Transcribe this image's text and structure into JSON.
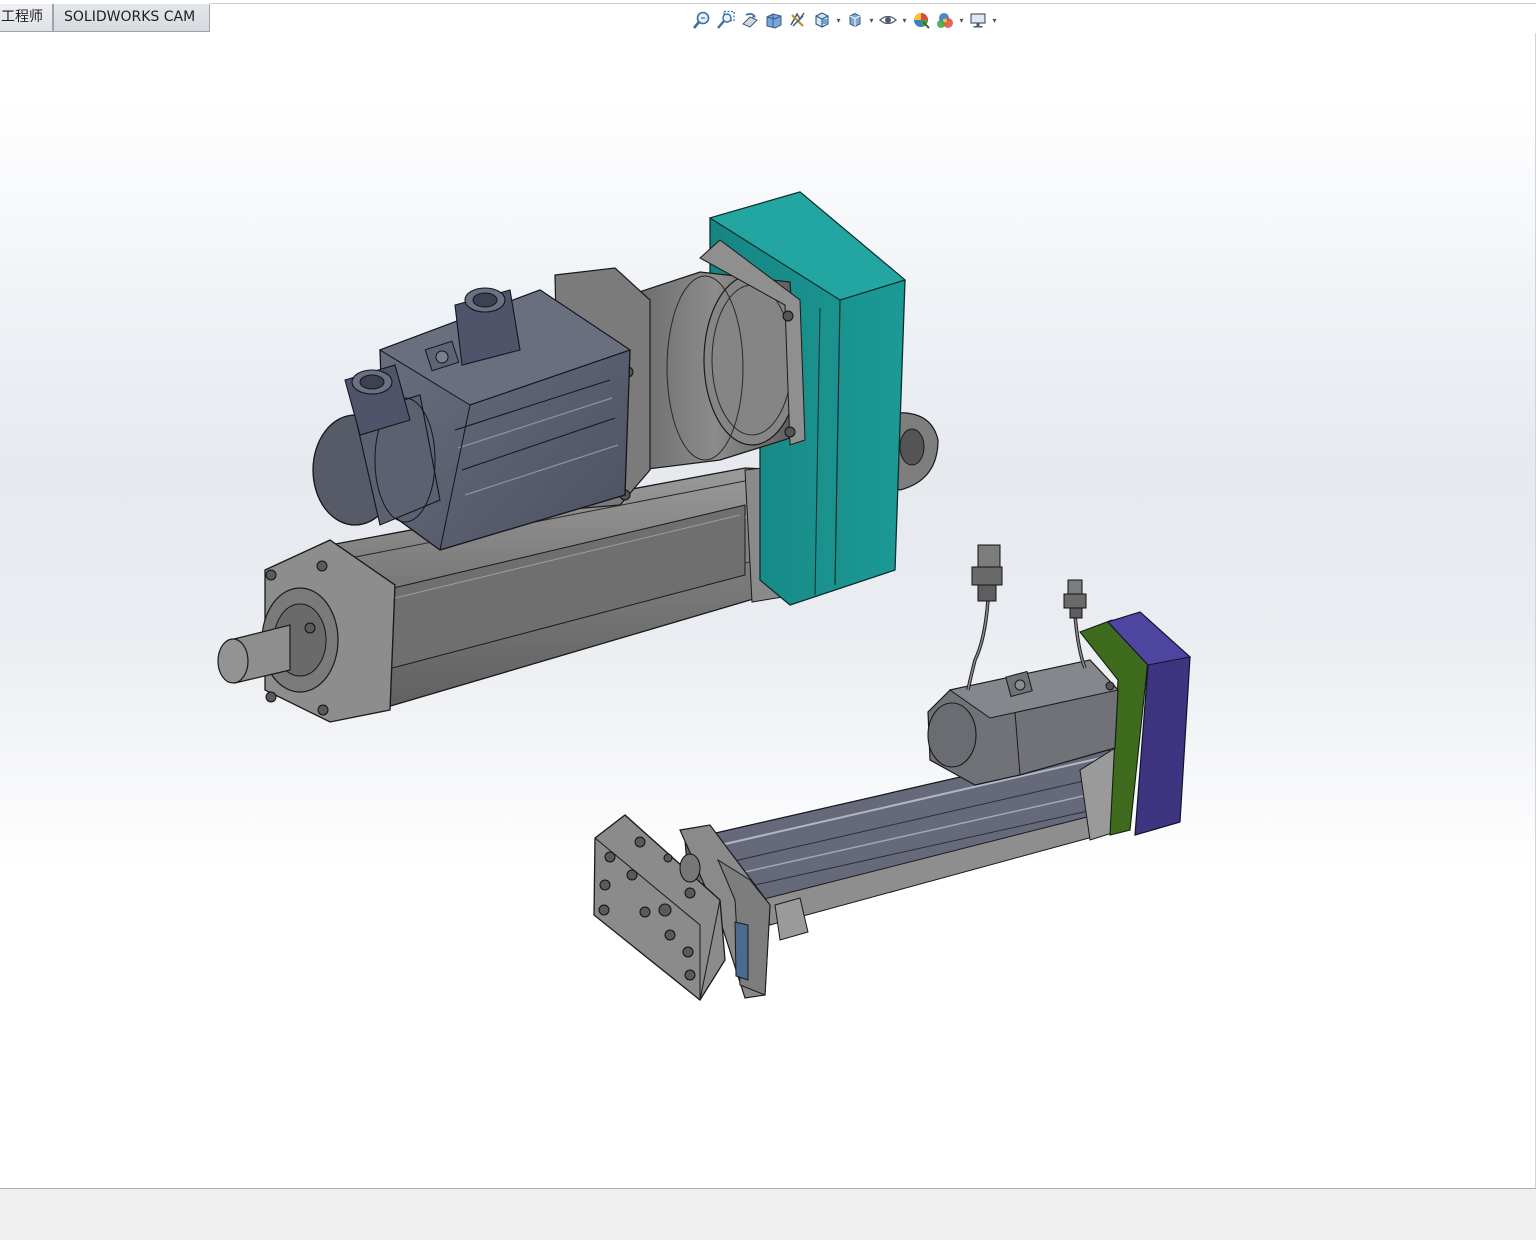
{
  "command_tabs": {
    "engineer_label": "工程师",
    "cam_label": "SOLIDWORKS CAM"
  },
  "heads_up_toolbar": {
    "items": [
      {
        "icon": "zoom-to-fit-icon"
      },
      {
        "icon": "zoom-to-area-icon"
      },
      {
        "icon": "previous-view-icon"
      },
      {
        "icon": "section-view-icon"
      },
      {
        "icon": "dynamic-annotation-icon"
      },
      {
        "icon": "view-orientation-icon"
      },
      {
        "icon": "display-style-icon"
      },
      {
        "icon": "hide-show-items-icon"
      },
      {
        "icon": "edit-appearance-icon"
      },
      {
        "icon": "apply-scene-icon"
      },
      {
        "icon": "view-settings-icon"
      }
    ]
  },
  "model": {
    "assemblies": [
      {
        "name": "large-servo-electric-cylinder",
        "housing_color": "#1a8f8c",
        "motor_color": "#5e6373"
      },
      {
        "name": "small-servo-electric-cylinder",
        "housing_color": "#3d3580",
        "band_color": "#3e6b1e",
        "motor_color": "#6e7078"
      }
    ]
  }
}
